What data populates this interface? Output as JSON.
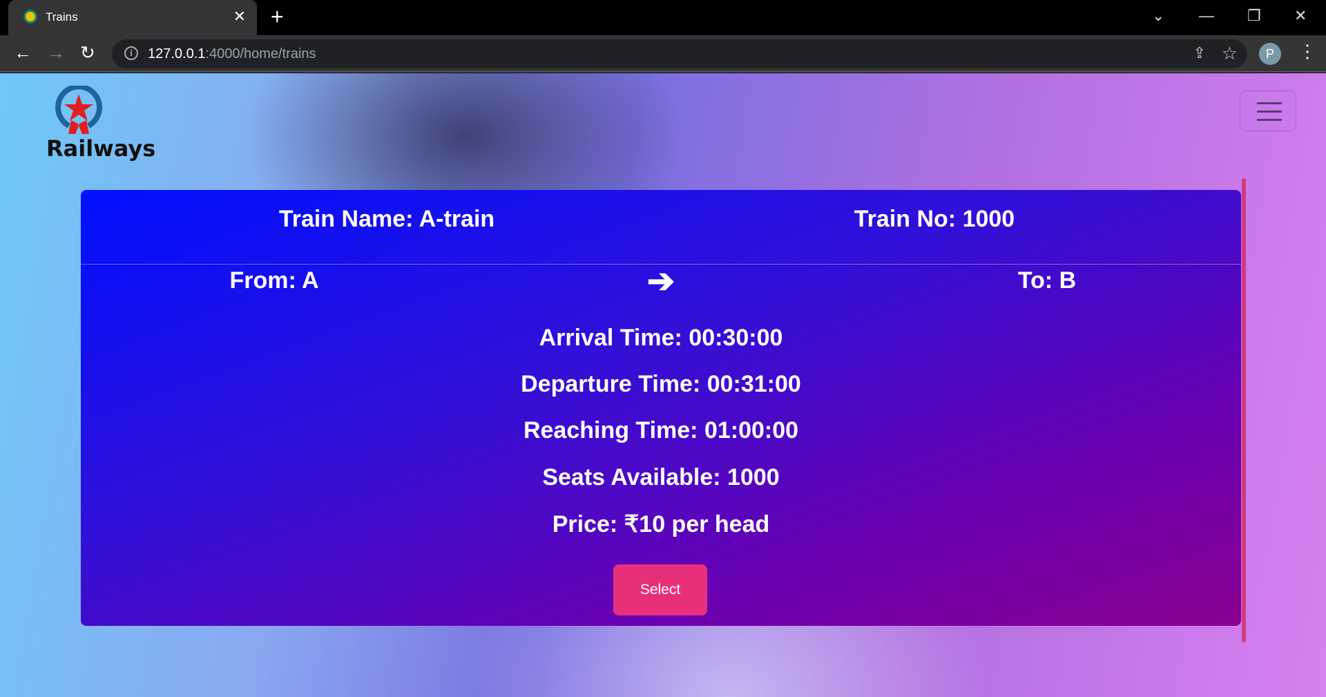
{
  "browser": {
    "tab_title": "Trains",
    "url_host": "127.0.0.1",
    "url_rest": ":4000/home/trains",
    "profile_initial": "P"
  },
  "brand": {
    "name": "Railways"
  },
  "train": {
    "name_label": "Train Name: A-train",
    "number_label": "Train No: 1000",
    "from_label": "From: A",
    "to_label": "To: B",
    "arrival": "Arrival Time: 00:30:00",
    "departure": "Departure Time: 00:31:00",
    "reaching": "Reaching Time: 01:00:00",
    "seats": "Seats Available: 1000",
    "price": "Price: ₹10 per head",
    "select_label": "Select"
  },
  "colors": {
    "accent": "#e8307a",
    "card_start": "#0010ff",
    "card_end": "#8a0090"
  }
}
